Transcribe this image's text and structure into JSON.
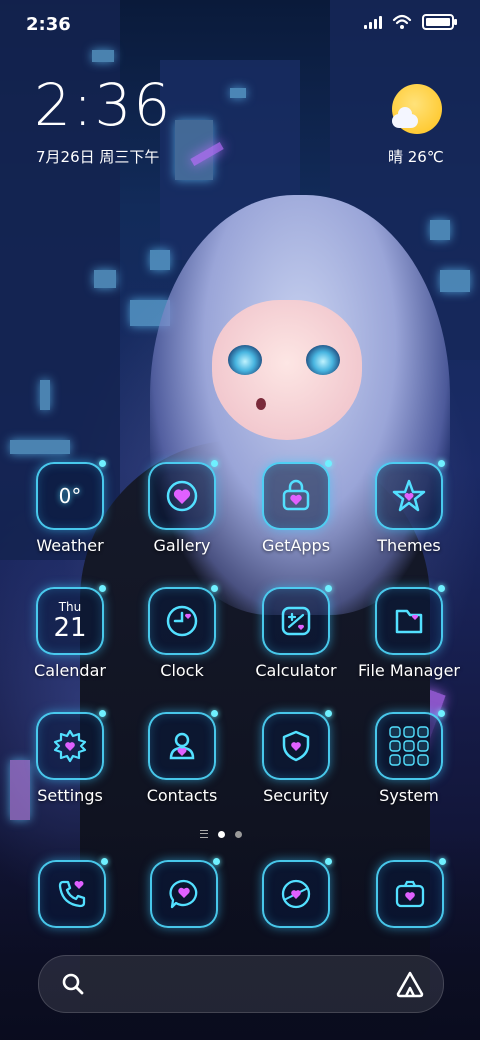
{
  "status_bar": {
    "time": "2:36"
  },
  "clock_widget": {
    "time": "2:36",
    "date": "7月26日 周三下午",
    "weather": "晴 26℃"
  },
  "apps": [
    {
      "id": "weather",
      "label": "Weather",
      "glyph": "0°",
      "icon": "weather-icon"
    },
    {
      "id": "gallery",
      "label": "Gallery",
      "icon": "gallery-icon"
    },
    {
      "id": "getapps",
      "label": "GetApps",
      "icon": "getapps-icon"
    },
    {
      "id": "themes",
      "label": "Themes",
      "icon": "themes-icon"
    },
    {
      "id": "calendar",
      "label": "Calendar",
      "day": "Thu",
      "date": "21",
      "icon": "calendar-icon"
    },
    {
      "id": "clock",
      "label": "Clock",
      "icon": "clock-icon"
    },
    {
      "id": "calculator",
      "label": "Calculator",
      "icon": "calculator-icon"
    },
    {
      "id": "filemanager",
      "label": "File Manager",
      "icon": "file-manager-icon"
    },
    {
      "id": "settings",
      "label": "Settings",
      "icon": "settings-icon"
    },
    {
      "id": "contacts",
      "label": "Contacts",
      "icon": "contacts-icon"
    },
    {
      "id": "security",
      "label": "Security",
      "icon": "security-icon"
    },
    {
      "id": "system",
      "label": "System",
      "icon": "system-folder-icon"
    }
  ],
  "dock": [
    {
      "id": "phone",
      "icon": "phone-icon"
    },
    {
      "id": "messages",
      "icon": "messages-icon"
    },
    {
      "id": "browser",
      "icon": "browser-icon"
    },
    {
      "id": "camera",
      "icon": "camera-icon"
    }
  ],
  "page_indicator": {
    "pages": 2,
    "current": 1
  },
  "search_bar": {
    "left_icon": "search-icon",
    "right_icon": "assistant-icon"
  },
  "colors": {
    "neon": "#50dcff",
    "accent_pink": "#e060ff"
  }
}
